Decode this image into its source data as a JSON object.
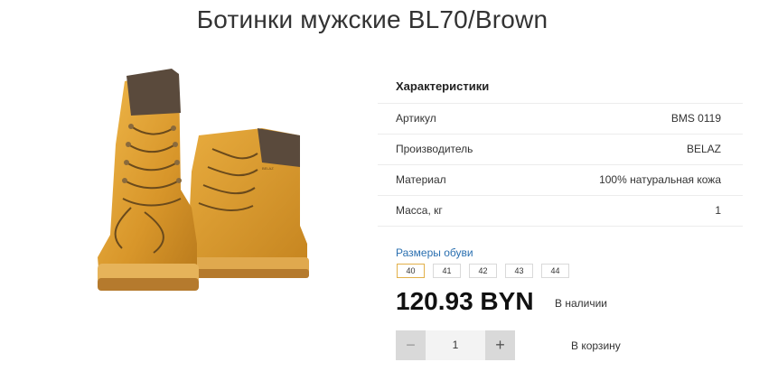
{
  "page": {
    "title": "Ботинки мужские BL70/Brown"
  },
  "product": {
    "image_icon": "boots-product-image",
    "boot_brand_text": "BELAZ"
  },
  "specs": {
    "title": "Характеристики",
    "rows": [
      {
        "label": "Артикул",
        "value": "BMS 0119"
      },
      {
        "label": "Производитель",
        "value": "BELAZ"
      },
      {
        "label": "Материал",
        "value": "100% натуральная кожа"
      },
      {
        "label": "Масса, кг",
        "value": "1"
      }
    ]
  },
  "sizes": {
    "label": "Размеры обуви",
    "options": [
      "40",
      "41",
      "42",
      "43",
      "44"
    ],
    "selected": "40",
    "accent_color": "#e2b04a"
  },
  "price": {
    "value": "120.93 BYN",
    "stock": "В наличии"
  },
  "quantity": {
    "minus_label": "−",
    "value": "1",
    "plus_label": "+"
  },
  "cart": {
    "label": "В корзину"
  },
  "colors": {
    "link": "#2a6fb0",
    "boot_leather": "#d99a2b",
    "boot_collar": "#5a4a3c"
  }
}
